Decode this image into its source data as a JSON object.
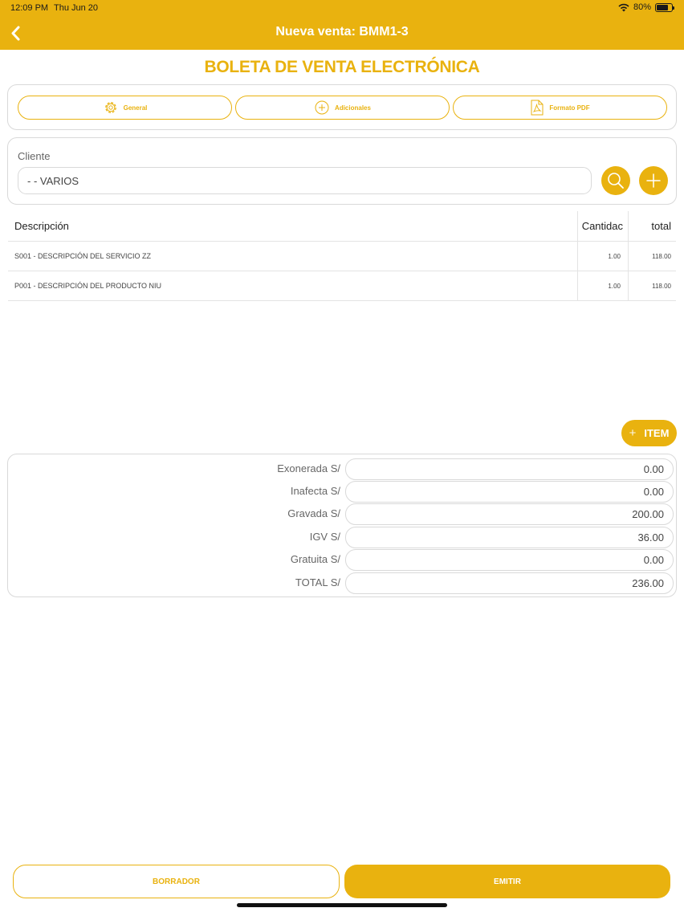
{
  "status_bar": {
    "time": "12:09 PM",
    "date": "Thu Jun 20",
    "battery": "80%",
    "battery_level": 0.8
  },
  "nav": {
    "title": "Nueva venta: BMM1-3"
  },
  "document_title": "BOLETA DE VENTA ELECTRÓNICA",
  "tabs": [
    {
      "label": "General",
      "icon": "gear-icon"
    },
    {
      "label": "Adicionales",
      "icon": "plus-circle-icon"
    },
    {
      "label": "Formato PDF",
      "icon": "pdf-icon"
    }
  ],
  "client": {
    "label": "Cliente",
    "value": "- - VARIOS"
  },
  "items_table": {
    "headers": {
      "description": "Descripción",
      "quantity": "Cantidac",
      "total": "total"
    },
    "rows": [
      {
        "description": "S001 - DESCRIPCIÓN DEL SERVICIO ZZ",
        "quantity": "1.00",
        "total": "118.00"
      },
      {
        "description": "P001 - DESCRIPCIÓN DEL PRODUCTO NIU",
        "quantity": "1.00",
        "total": "118.00"
      }
    ]
  },
  "add_item": {
    "plus": "+",
    "label": "ITEM"
  },
  "totals": [
    {
      "label": "Exonerada S/",
      "value": "0.00"
    },
    {
      "label": "Inafecta S/",
      "value": "0.00"
    },
    {
      "label": "Gravada S/",
      "value": "200.00"
    },
    {
      "label": "IGV S/",
      "value": "36.00"
    },
    {
      "label": "Gratuita S/",
      "value": "0.00"
    },
    {
      "label": "TOTAL S/",
      "value": "236.00"
    }
  ],
  "actions": {
    "draft": "BORRADOR",
    "emit": "EMITIR"
  },
  "colors": {
    "accent": "#E9B20F",
    "border": "#d9d9d9",
    "text": "#444444"
  }
}
